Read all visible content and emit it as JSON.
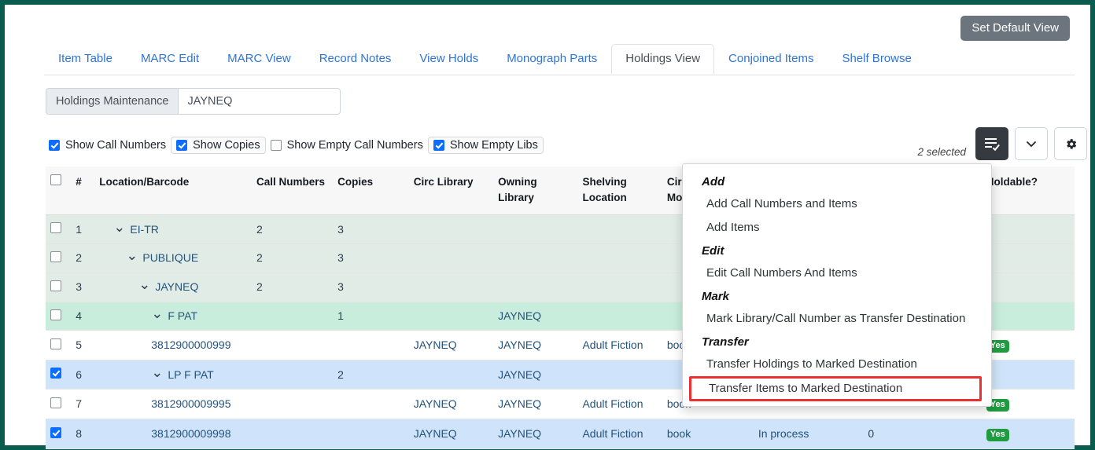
{
  "header": {
    "set_default_view": "Set Default View"
  },
  "tabs": [
    {
      "label": "Item Table",
      "active": false
    },
    {
      "label": "MARC Edit",
      "active": false
    },
    {
      "label": "MARC View",
      "active": false
    },
    {
      "label": "Record Notes",
      "active": false
    },
    {
      "label": "View Holds",
      "active": false
    },
    {
      "label": "Monograph Parts",
      "active": false
    },
    {
      "label": "Holdings View",
      "active": true
    },
    {
      "label": "Conjoined Items",
      "active": false
    },
    {
      "label": "Shelf Browse",
      "active": false
    }
  ],
  "search": {
    "group_label": "Holdings Maintenance",
    "value": "JAYNEQ",
    "placeholder": ""
  },
  "filters": [
    {
      "label": "Show Call Numbers",
      "checked": true,
      "boxed": false
    },
    {
      "label": "Show Copies",
      "checked": true,
      "boxed": true
    },
    {
      "label": "Show Empty Call Numbers",
      "checked": false,
      "boxed": false
    },
    {
      "label": "Show Empty Libs",
      "checked": true,
      "boxed": true
    }
  ],
  "toolbar": {
    "selected_text": "2 selected",
    "actions_icon": "list-check-icon",
    "chevron_icon": "chevron-down-icon",
    "settings_icon": "gear-icon"
  },
  "table": {
    "columns": [
      "",
      "#",
      "Location/Barcode",
      "Call Numbers",
      "Copies",
      "Circ Library",
      "Owning Library",
      "Shelving Location",
      "Circulation Modifier",
      "",
      "",
      "Holdable?"
    ],
    "rows": [
      {
        "n": "1",
        "loc": "EI-TR",
        "indent": 1,
        "chevron": true,
        "call": "2",
        "copies": "3",
        "circ": "",
        "own": "",
        "shelf": "",
        "mod": "",
        "x1": "",
        "x2": "",
        "hold": "",
        "style": "mint"
      },
      {
        "n": "2",
        "loc": "PUBLIQUE",
        "indent": 2,
        "chevron": true,
        "call": "2",
        "copies": "3",
        "circ": "",
        "own": "",
        "shelf": "",
        "mod": "",
        "x1": "",
        "x2": "",
        "hold": "",
        "style": "mint"
      },
      {
        "n": "3",
        "loc": "JAYNEQ",
        "indent": 3,
        "chevron": true,
        "call": "2",
        "copies": "3",
        "circ": "",
        "own": "",
        "shelf": "",
        "mod": "",
        "x1": "",
        "x2": "",
        "hold": "",
        "style": "mint"
      },
      {
        "n": "4",
        "loc": "F PAT",
        "indent": 4,
        "chevron": true,
        "call": "",
        "copies": "1",
        "circ": "",
        "own": "JAYNEQ",
        "shelf": "",
        "mod": "",
        "x1": "",
        "x2": "",
        "hold": "",
        "style": "mint2"
      },
      {
        "n": "5",
        "loc": "3812900000999",
        "indent": 4,
        "chevron": false,
        "call": "",
        "copies": "",
        "circ": "JAYNEQ",
        "own": "JAYNEQ",
        "shelf": "Adult Fiction",
        "mod": "book",
        "x1": "",
        "x2": "",
        "hold": "Yes",
        "style": "white"
      },
      {
        "n": "6",
        "loc": "LP F PAT",
        "indent": 4,
        "chevron": true,
        "call": "",
        "copies": "2",
        "circ": "",
        "own": "JAYNEQ",
        "shelf": "",
        "mod": "",
        "x1": "",
        "x2": "",
        "hold": "",
        "style": "blue",
        "checked": true
      },
      {
        "n": "7",
        "loc": "3812900009995",
        "indent": 4,
        "chevron": false,
        "call": "",
        "copies": "",
        "circ": "JAYNEQ",
        "own": "JAYNEQ",
        "shelf": "Adult Fiction",
        "mod": "book",
        "x1": "",
        "x2": "",
        "hold": "Yes",
        "style": "white"
      },
      {
        "n": "8",
        "loc": "3812900009998",
        "indent": 4,
        "chevron": false,
        "call": "",
        "copies": "",
        "circ": "JAYNEQ",
        "own": "JAYNEQ",
        "shelf": "Adult Fiction",
        "mod": "book",
        "x1": "In process",
        "x2": "0",
        "hold": "Yes",
        "style": "blue",
        "checked": true
      }
    ],
    "holdable_yes": "Yes"
  },
  "menu": {
    "groups": [
      {
        "heading": "Add",
        "items": [
          "Add Call Numbers and Items",
          "Add Items"
        ]
      },
      {
        "heading": "Edit",
        "items": [
          "Edit Call Numbers And Items"
        ]
      },
      {
        "heading": "Mark",
        "items": [
          "Mark Library/Call Number as Transfer Destination"
        ]
      },
      {
        "heading": "Transfer",
        "items": [
          "Transfer Holdings to Marked Destination",
          "Transfer Items to Marked Destination"
        ]
      }
    ],
    "highlighted_item": "Transfer Items to Marked Destination",
    "highlight_color": "#ee2f2f"
  },
  "colors": {
    "frame_border": "#0a5c4e",
    "tab_link": "#2e74d8",
    "primary_button": "#343a40",
    "row_mint": "#e2ece6",
    "row_mint_strong": "#c9eddd",
    "row_selected": "#cfe3fa",
    "badge_green": "#1f9c40"
  }
}
